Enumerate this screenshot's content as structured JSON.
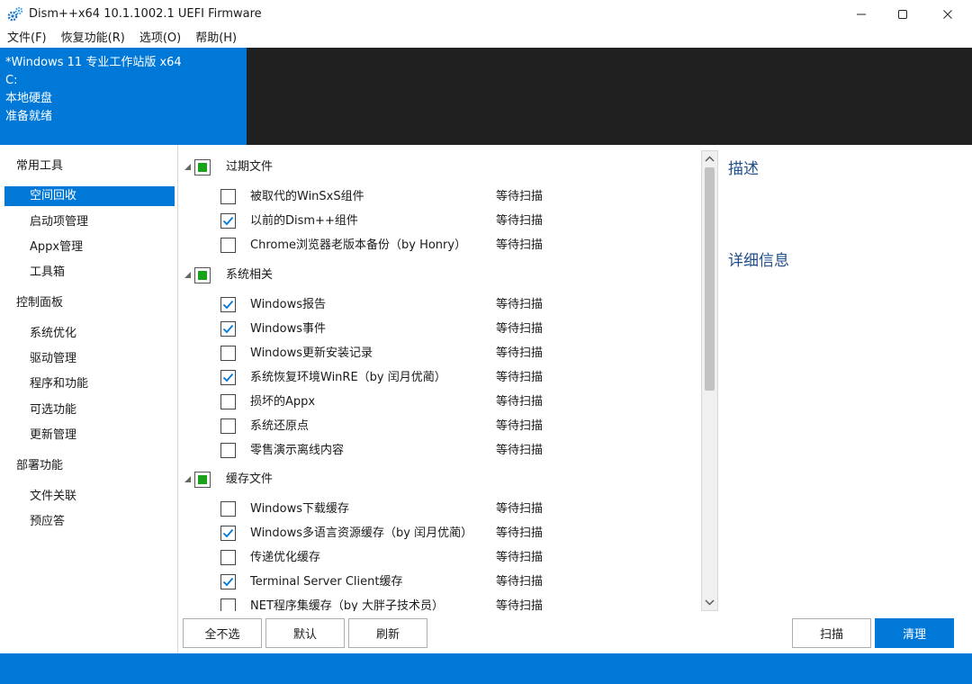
{
  "window": {
    "title": "Dism++x64 10.1.1002.1 UEFI Firmware",
    "controls": [
      "minimize",
      "maximize",
      "close"
    ]
  },
  "menu": [
    "文件(F)",
    "恢复功能(R)",
    "选项(O)",
    "帮助(H)"
  ],
  "info": {
    "os": "*Windows 11 专业工作站版 x64",
    "drive": "C:",
    "disk_type": "本地硬盘",
    "status": "准备就绪"
  },
  "sidebar": {
    "groups": [
      {
        "label": "常用工具",
        "items": [
          "空间回收",
          "启动项管理",
          "Appx管理",
          "工具箱"
        ]
      },
      {
        "label": "控制面板",
        "items": [
          "系统优化",
          "驱动管理",
          "程序和功能",
          "可选功能",
          "更新管理"
        ]
      },
      {
        "label": "部署功能",
        "items": [
          "文件关联",
          "预应答"
        ]
      }
    ],
    "active_item": "空间回收"
  },
  "list": {
    "groups": [
      {
        "label": "过期文件",
        "items": [
          {
            "label": "被取代的WinSxS组件",
            "status": "等待扫描",
            "checked": false
          },
          {
            "label": "以前的Dism++组件",
            "status": "等待扫描",
            "checked": true
          },
          {
            "label": "Chrome浏览器老版本备份（by Honry）",
            "status": "等待扫描",
            "checked": false
          }
        ]
      },
      {
        "label": "系统相关",
        "items": [
          {
            "label": "Windows报告",
            "status": "等待扫描",
            "checked": true
          },
          {
            "label": "Windows事件",
            "status": "等待扫描",
            "checked": true
          },
          {
            "label": "Windows更新安装记录",
            "status": "等待扫描",
            "checked": false
          },
          {
            "label": "系统恢复环境WinRE（by 闰月优蔺）",
            "status": "等待扫描",
            "checked": true
          },
          {
            "label": "损坏的Appx",
            "status": "等待扫描",
            "checked": false
          },
          {
            "label": "系统还原点",
            "status": "等待扫描",
            "checked": false
          },
          {
            "label": "零售演示离线内容",
            "status": "等待扫描",
            "checked": false
          }
        ]
      },
      {
        "label": "缓存文件",
        "items": [
          {
            "label": "Windows下载缓存",
            "status": "等待扫描",
            "checked": false
          },
          {
            "label": "Windows多语言资源缓存（by 闰月优蔺）",
            "status": "等待扫描",
            "checked": true
          },
          {
            "label": "传递优化缓存",
            "status": "等待扫描",
            "checked": false
          },
          {
            "label": "Terminal Server Client缓存",
            "status": "等待扫描",
            "checked": true
          },
          {
            "label": "NET程序集缓存（by 大胖子技术员）",
            "status": "等待扫描",
            "checked": false
          }
        ]
      }
    ]
  },
  "detail": {
    "description_title": "描述",
    "details_title": "详细信息"
  },
  "buttons": {
    "deselect_all": "全不选",
    "default": "默认",
    "refresh": "刷新",
    "scan": "扫描",
    "clean": "清理"
  },
  "colors": {
    "accent": "#0078d7",
    "group_check_fill": "#1aa31a",
    "check_mark": "#0078d7",
    "detail_title": "#1f4e8c"
  }
}
